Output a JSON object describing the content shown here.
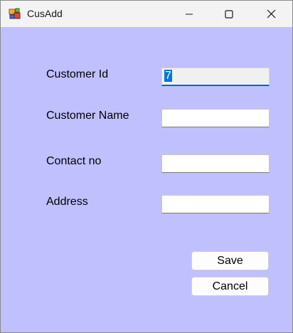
{
  "window": {
    "title": "CusAdd"
  },
  "form": {
    "customer_id_label": "Customer Id",
    "customer_id_value": "7",
    "customer_name_label": "Customer Name",
    "customer_name_value": "",
    "contact_no_label": "Contact no",
    "contact_no_value": "",
    "address_label": "Address",
    "address_value": ""
  },
  "buttons": {
    "save_label": "Save",
    "cancel_label": "Cancel"
  },
  "colors": {
    "form_background": "#c0c0ff",
    "title_bar": "#f3f3f3",
    "selection": "#0078d4",
    "focus_underline": "#0067c0"
  },
  "icons": {
    "app": "app-icon",
    "minimize": "minimize-icon",
    "maximize": "maximize-icon",
    "close": "close-icon"
  }
}
